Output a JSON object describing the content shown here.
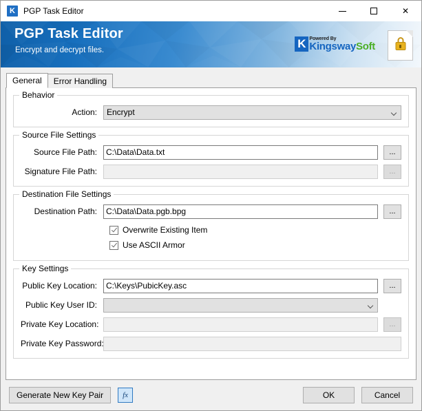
{
  "window": {
    "title": "PGP Task Editor",
    "icon": "K",
    "minimize_label": "Minimize",
    "maximize_label": "Maximize",
    "close_label": "Close",
    "close_glyph": "✕"
  },
  "banner": {
    "title": "PGP Task Editor",
    "subtitle": "Encrypt and decrypt files.",
    "brand_k": "K",
    "brand_powered": "Powered By",
    "brand_kingsway": "Kingsway",
    "brand_soft": "Soft",
    "accent_blue": "#1565c0",
    "accent_green": "#4caf27",
    "lock_color": "#e8b21e"
  },
  "tabs": [
    {
      "label": "General",
      "active": true
    },
    {
      "label": "Error Handling",
      "active": false
    }
  ],
  "groups": {
    "behavior": {
      "legend": "Behavior",
      "action_label": "Action:",
      "action_value": "Encrypt"
    },
    "source": {
      "legend": "Source File Settings",
      "source_path_label": "Source File Path:",
      "source_path_value": "C:\\Data\\Data.txt",
      "signature_path_label": "Signature File Path:",
      "signature_path_value": "",
      "browse_label": "..."
    },
    "destination": {
      "legend": "Destination File Settings",
      "destination_path_label": "Destination Path:",
      "destination_path_value": "C:\\Data\\Data.pgb.bpg",
      "overwrite_label": "Overwrite Existing Item",
      "ascii_armor_label": "Use ASCII Armor",
      "browse_label": "..."
    },
    "key": {
      "legend": "Key Settings",
      "public_key_location_label": "Public Key Location:",
      "public_key_location_value": "C:\\Keys\\PubicKey.asc",
      "public_key_userid_label": "Public Key User ID:",
      "public_key_userid_value": "",
      "private_key_location_label": "Private Key Location:",
      "private_key_location_value": "",
      "private_key_password_label": "Private Key Password:",
      "private_key_password_value": "",
      "browse_label": "..."
    }
  },
  "footer": {
    "generate_key_label": "Generate New Key Pair",
    "expression_label": "fx",
    "ok_label": "OK",
    "cancel_label": "Cancel"
  }
}
